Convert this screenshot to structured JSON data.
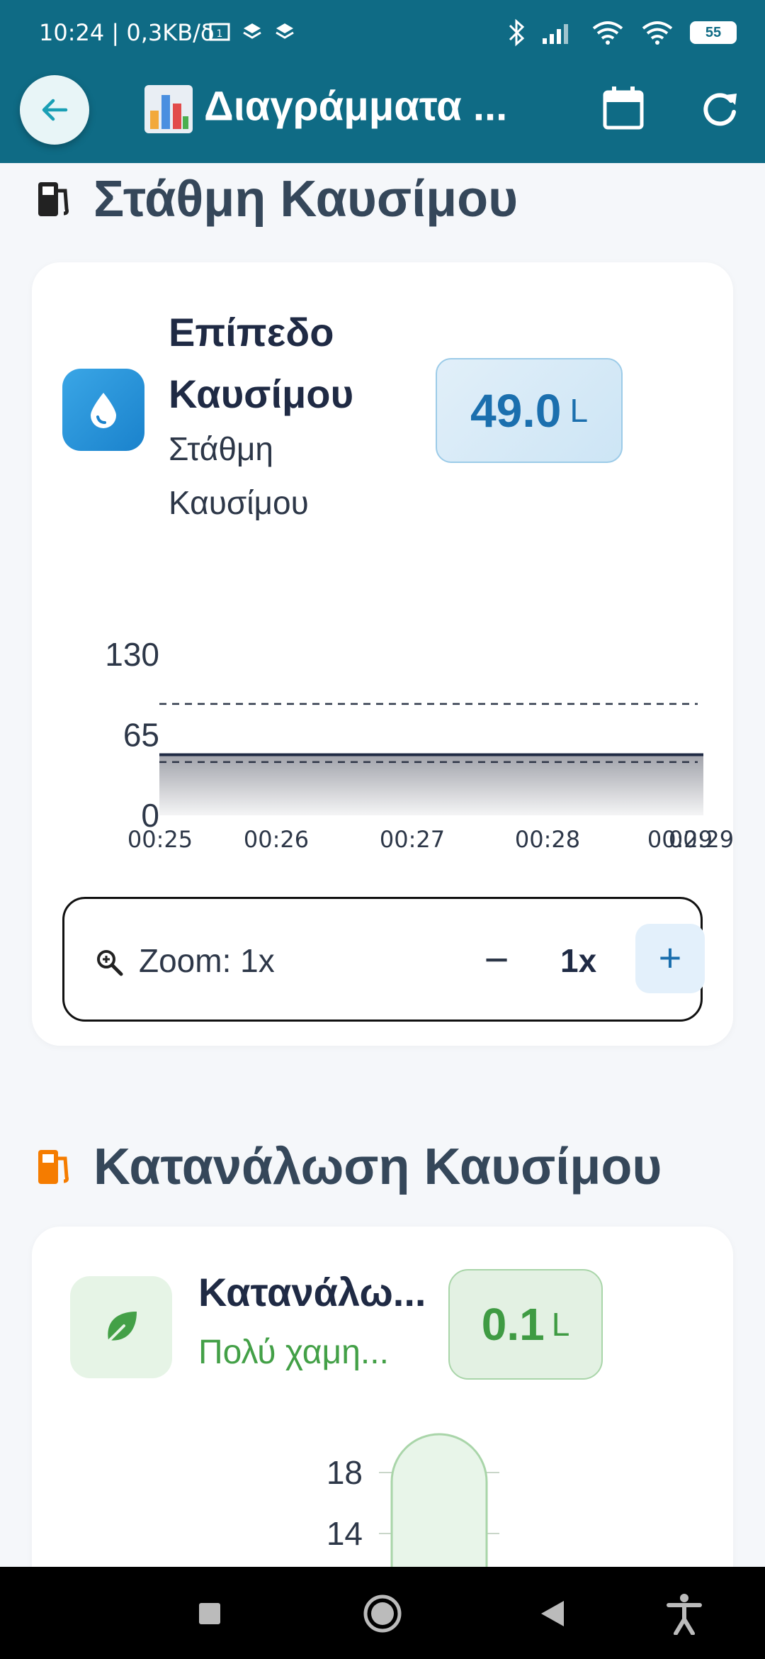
{
  "status_bar": {
    "time": "10:24 | 0,3KB/δ",
    "battery": "55"
  },
  "app_bar": {
    "title": "Διαγράμματα ...",
    "icons": [
      "back-arrow-icon",
      "bar-chart-icon",
      "calendar-icon",
      "refresh-icon"
    ]
  },
  "section_fuel_level": {
    "title": "Στάθμη Καυσίμου",
    "card": {
      "title": "Επίπεδο Καυσίμου",
      "subtitle": "Στάθμη Καυσίμου",
      "value": "49.0",
      "unit": "L"
    }
  },
  "zoom": {
    "label": "Zoom: 1x",
    "minus": "−",
    "value": "1x",
    "plus": "+"
  },
  "section_consumption": {
    "title": "Κατανάλωση Καυσίμου",
    "card": {
      "title": "Κατανάλω...",
      "subtitle": "Πολύ χαμη...",
      "value": "0.1",
      "unit": "L"
    }
  },
  "colors": {
    "primary": "#0f6b85",
    "blue_accent": "#1b6fae",
    "green_accent": "#43a047",
    "orange_icon": "#f57c00"
  },
  "chart_data": [
    {
      "type": "area",
      "x": [
        "00:25",
        "00:26",
        "00:27",
        "00:28",
        "00:29"
      ],
      "y": [
        49,
        49,
        49,
        49,
        49
      ],
      "ylim": [
        0,
        130
      ],
      "yticks": [
        0,
        65,
        130
      ],
      "reference_lines": [
        90,
        43
      ],
      "grid": false,
      "extra_x_tick_label": "00:29"
    },
    {
      "type": "bar",
      "yticks_visible": [
        14,
        18
      ],
      "partial": true
    }
  ]
}
